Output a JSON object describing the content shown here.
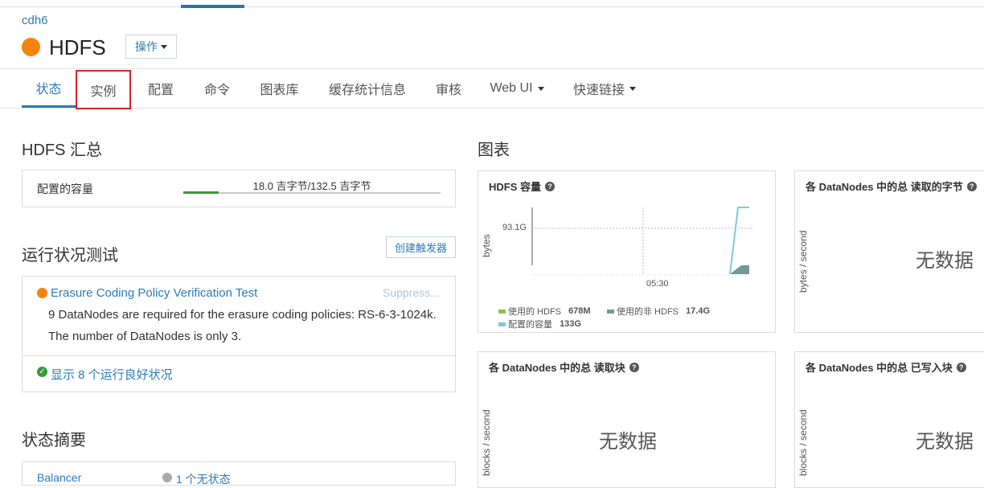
{
  "header": {
    "cluster": "cdh6",
    "service": "HDFS",
    "actions_label": "操作"
  },
  "tabs": [
    {
      "label": "状态"
    },
    {
      "label": "实例"
    },
    {
      "label": "配置"
    },
    {
      "label": "命令"
    },
    {
      "label": "图表库"
    },
    {
      "label": "缓存统计信息"
    },
    {
      "label": "审核"
    },
    {
      "label": "Web UI"
    },
    {
      "label": "快速链接"
    }
  ],
  "summary": {
    "title": "HDFS 汇总",
    "capacity_label": "配置的容量",
    "capacity_value": "18.0 吉字节/132.5 吉字节",
    "capacity_used_fraction": 0.136
  },
  "health": {
    "title": "运行状况测试",
    "create_trigger": "创建触发器",
    "test_name": "Erasure Coding Policy Verification Test",
    "suppress": "Suppress...",
    "line1": "9 DataNodes are required for the erasure coding policies: RS-6-3-1024k.",
    "line2": "The number of DataNodes is only 3.",
    "good_link": "显示 8 个运行良好状况"
  },
  "status_summary": {
    "title": "状态摘要",
    "row_name": "Balancer",
    "row_status": "1 个无状态"
  },
  "charts": {
    "title": "图表",
    "no_data": "无数据",
    "c1": {
      "title": "HDFS 容量",
      "ylabel": "bytes",
      "ytick": "93.1G",
      "xtick": "05:30",
      "legend": [
        {
          "label": "使用的 HDFS",
          "value": "678M",
          "color": "#8cc152"
        },
        {
          "label": "使用的非 HDFS",
          "value": "17.4G",
          "color": "#6f9c95"
        },
        {
          "label": "配置的容量",
          "value": "133G",
          "color": "#7ec8e3"
        }
      ]
    },
    "c2": {
      "title": "各 DataNodes 中的总 读取的字节",
      "ylabel": "bytes / second"
    },
    "c3": {
      "title": "各 DataNodes 中的总 读取块",
      "ylabel": "blocks / second"
    },
    "c4": {
      "title": "各 DataNodes 中的总 已写入块",
      "ylabel": "blocks / second"
    }
  }
}
